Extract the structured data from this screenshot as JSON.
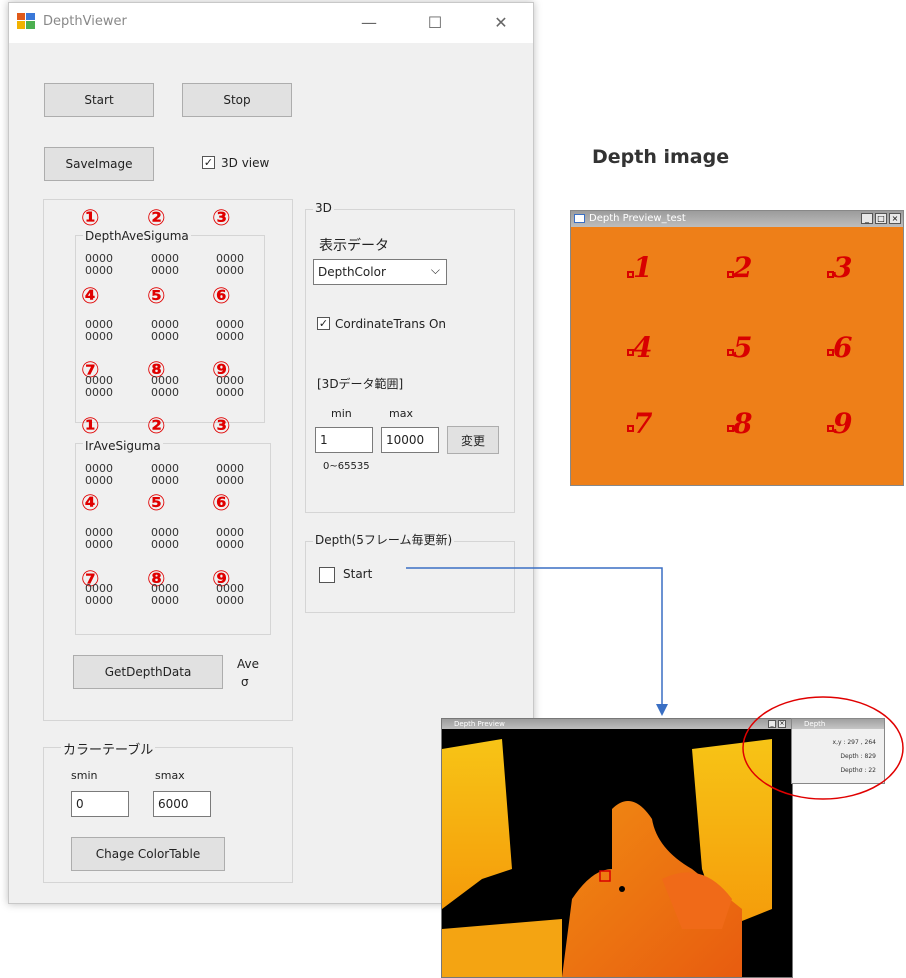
{
  "window": {
    "title": "DepthViewer",
    "min_glyph": "—",
    "max_glyph": "☐",
    "close_glyph": "✕"
  },
  "controls": {
    "start": "Start",
    "stop": "Stop",
    "save_image": "SaveImage",
    "view3d_label": "3D view",
    "get_depth": "GetDepthData",
    "ave_label": "Ave",
    "sigma_label": "σ"
  },
  "depth_group": {
    "title": "DepthAveSiguma",
    "markers": [
      "①",
      "②",
      "③",
      "④",
      "⑤",
      "⑥",
      "⑦",
      "⑧",
      "⑨"
    ],
    "values": "0000"
  },
  "ir_group": {
    "title": "IrAveSiguma",
    "markers": [
      "①",
      "②",
      "③",
      "④",
      "⑤",
      "⑥",
      "⑦",
      "⑧",
      "⑨"
    ],
    "values": "0000"
  },
  "group3d": {
    "title": "3D",
    "display_data_label": "表示データ",
    "display_select": "DepthColor",
    "coord_trans_label": "CordinateTrans On",
    "range_label": "[3Dデータ範囲]",
    "min_label": "min",
    "max_label": "max",
    "min_value": "1",
    "max_value": "10000",
    "change_button": "変更",
    "range_hint": "0~65535"
  },
  "depth_update": {
    "title": "Depth(5フレーム毎更新)",
    "start_label": "Start"
  },
  "color_table": {
    "title": "カラーテーブル",
    "smin_label": "smin",
    "smax_label": "smax",
    "smin_value": "0",
    "smax_value": "6000",
    "button": "Chage ColorTable"
  },
  "depth_image_heading": "Depth image",
  "preview_window": {
    "title": "Depth Preview_test",
    "digits": [
      "1",
      "2",
      "3",
      "4",
      "5",
      "6",
      "7",
      "8",
      "9"
    ],
    "color": "#ee7f18"
  },
  "depth_preview": {
    "title": "Depth Preview"
  },
  "info_window": {
    "title": "Depth",
    "xy": "x,y : 297 , 264",
    "depth": "Depth : 829",
    "sigma": "Depthσ : 22"
  }
}
